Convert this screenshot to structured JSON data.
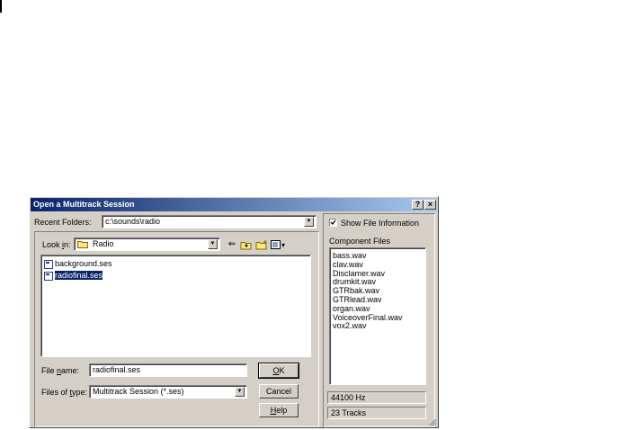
{
  "dialog": {
    "title": "Open a Multitrack Session",
    "help_glyph": "?",
    "close_glyph": "×"
  },
  "recent": {
    "label": "Recent Folders:",
    "value": "c:\\sounds\\radio"
  },
  "look_in": {
    "label_pre": "Look ",
    "label_key": "i",
    "label_post": "n:",
    "value": "Radio"
  },
  "toolbar": {
    "back_glyph": "⇐",
    "view_menu_glyph": "▾"
  },
  "files": [
    {
      "name": "background.ses",
      "selected": false
    },
    {
      "name": "radiofinal.ses",
      "selected": true
    }
  ],
  "file_name": {
    "label_pre": "File ",
    "label_key": "n",
    "label_post": "ame:",
    "value": "radiofinal.ses"
  },
  "file_type": {
    "label_pre": "Files of ",
    "label_key": "t",
    "label_post": "ype:",
    "value": "Multitrack Session (*.ses)"
  },
  "buttons": {
    "ok_key": "O",
    "ok_rest": "K",
    "cancel": "Cancel",
    "help_key": "H",
    "help_rest": "elp"
  },
  "info": {
    "show_label": "Show File Information",
    "show_checked": true,
    "components_label": "Component Files",
    "components": [
      "bass.wav",
      "clav.wav",
      "Disclamer.wav",
      "drumkit.wav",
      "GTRbak.wav",
      "GTRlead.wav",
      "organ.wav",
      "VoiceoverFinal.wav",
      "vox2.wav"
    ],
    "sample_rate": "44100 Hz",
    "tracks": "23 Tracks"
  },
  "colors": {
    "title_start": "#0a246a",
    "title_end": "#a6caf0",
    "face": "#d4d0c8",
    "selection": "#0a246a"
  },
  "icons": {
    "folder": "folder-icon",
    "back": "back-arrow-icon",
    "up_folder": "up-one-level-icon",
    "new_folder": "new-folder-icon",
    "view_menu": "view-menu-icon",
    "file": "session-file-icon"
  }
}
